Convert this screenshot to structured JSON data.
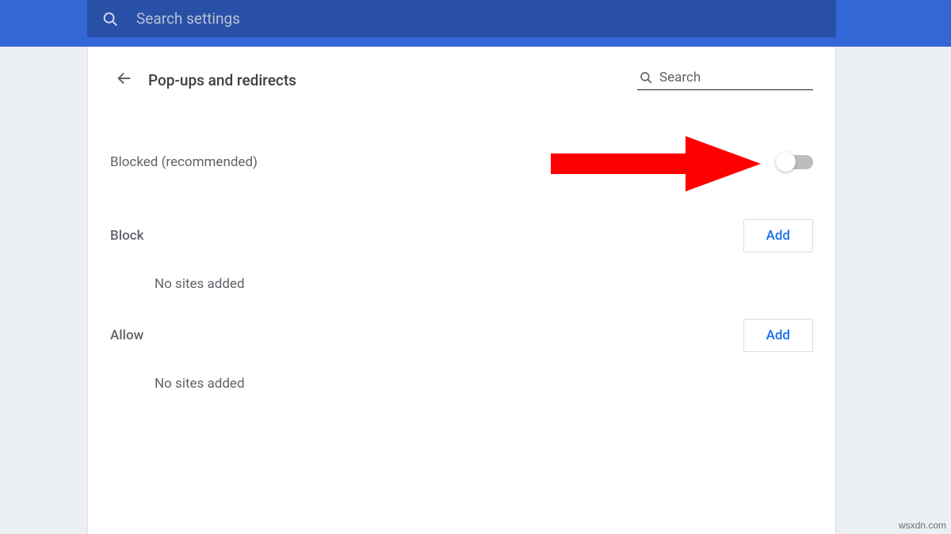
{
  "topbar": {
    "search_placeholder": "Search settings"
  },
  "header": {
    "title": "Pop-ups and redirects",
    "inline_search_placeholder": "Search"
  },
  "main": {
    "blocked_label": "Blocked (recommended)"
  },
  "sections": {
    "block": {
      "title": "Block",
      "add_label": "Add",
      "empty_text": "No sites added"
    },
    "allow": {
      "title": "Allow",
      "add_label": "Add",
      "empty_text": "No sites added"
    }
  },
  "watermark": "wsxdn.com"
}
